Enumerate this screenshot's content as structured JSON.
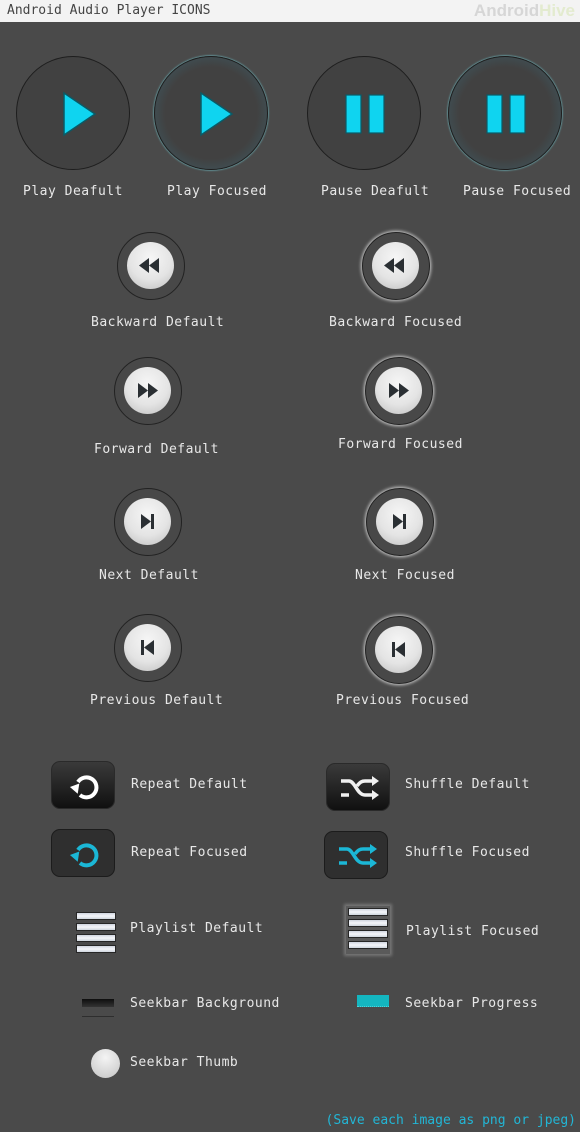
{
  "header": {
    "title": "Android Audio Player ICONS",
    "brand_part1": "Android",
    "brand_part2": "Hive"
  },
  "colors": {
    "accent": "#0fd4f0",
    "background": "#4a4a4a",
    "seekbar_progress": "#14b6c0",
    "footer_text": "#22b6d6"
  },
  "icons": {
    "play_default": {
      "label": "Play Deafult",
      "icon": "play-icon"
    },
    "play_focused": {
      "label": "Play Focused",
      "icon": "play-icon"
    },
    "pause_default": {
      "label": "Pause Deafult",
      "icon": "pause-icon"
    },
    "pause_focused": {
      "label": "Pause Focused",
      "icon": "pause-icon"
    },
    "backward_default": {
      "label": "Backward Default",
      "icon": "rewind-icon"
    },
    "backward_focused": {
      "label": "Backward Focused",
      "icon": "rewind-icon"
    },
    "forward_default": {
      "label": "Forward Default",
      "icon": "fast-forward-icon"
    },
    "forward_focused": {
      "label": "Forward Focused",
      "icon": "fast-forward-icon"
    },
    "next_default": {
      "label": "Next Default",
      "icon": "skip-next-icon"
    },
    "next_focused": {
      "label": "Next Focused",
      "icon": "skip-next-icon"
    },
    "previous_default": {
      "label": "Previous Default",
      "icon": "skip-previous-icon"
    },
    "previous_focused": {
      "label": "Previous Focused",
      "icon": "skip-previous-icon"
    },
    "repeat_default": {
      "label": "Repeat Default",
      "icon": "repeat-icon"
    },
    "repeat_focused": {
      "label": "Repeat Focused",
      "icon": "repeat-icon"
    },
    "shuffle_default": {
      "label": "Shuffle Default",
      "icon": "shuffle-icon"
    },
    "shuffle_focused": {
      "label": "Shuffle Focused",
      "icon": "shuffle-icon"
    },
    "playlist_default": {
      "label": "Playlist Default",
      "icon": "playlist-icon"
    },
    "playlist_focused": {
      "label": "Playlist Focused",
      "icon": "playlist-icon"
    },
    "seekbar_background": {
      "label": "Seekbar Background"
    },
    "seekbar_progress": {
      "label": "Seekbar Progress"
    },
    "seekbar_thumb": {
      "label": "Seekbar Thumb"
    }
  },
  "footer": {
    "note": "(Save each image as png or jpeg)"
  }
}
